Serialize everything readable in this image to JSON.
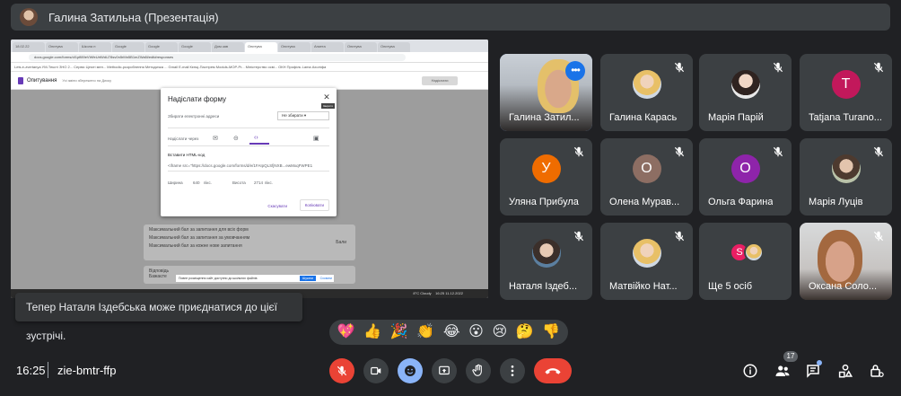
{
  "presenter_bar": {
    "name": "Галина Затильна (Презентація)"
  },
  "presentation": {
    "browser_tabs": [
      "18.02.22",
      "Опитува",
      "Школа н",
      "Google",
      "Google",
      "Google",
      "Дом.зав",
      "Опитува",
      "Опитува",
      "Анкета",
      "Опитува",
      "Опитува"
    ],
    "url": "docs.google.com/forms/d/1pfl89eVWfeUrtWdU78sv0n5rMn5B1mZWa5l/edit#responses",
    "bookmarks": "Lets.e-zvertanya   УМ-Тексті ЗНО 2...   Сервіс Ціноті мен...   Methodic-розроблення   Методичка ...   Gmail   E-mail   Кєнці-Пастірем   Moduls-MOP-Pr...   Міністерство осві...   ОКН Профіль   Lama Ахоліфа",
    "form_title": "Опитування",
    "form_subtitle": "Усі зміни збережено на Диску",
    "send_button": "Надіслати",
    "dialog": {
      "title": "Надіслати форму",
      "close_tooltip": "Закрити",
      "collect_emails_label": "Збирати електронні адреси",
      "collect_emails_value": "Не збирати",
      "send_via_label": "Надіслати через",
      "embed_label": "Вставити HTML-код",
      "embed_code": "<iframe src=\"https://docs.google.com/forms/d/e/1FAIpQLSfjNXB...ewMxqFWPE1",
      "width_label": "Ширина",
      "width_value": "640",
      "width_unit": "пікс.",
      "height_label": "Висота",
      "height_value": "2714",
      "height_unit": "пікс.",
      "cancel": "Скасувати",
      "copy": "Копіювати"
    },
    "form_lines": [
      "Максимальний бал за запитання для всіх форм",
      "Максимальний бал за запитання за умовчанням",
      "Максимальний бал за кожне нове запитання",
      "Відповідь",
      "Бажаєте"
    ],
    "points_label": "Бали",
    "bottom_notice": "Повне розміщення сайт доступно до шкільних файлів",
    "notice_btn1": "Шукати",
    "notice_btn2": "Сховати",
    "taskbar_temp": "8°C Cloudy",
    "taskbar_time": "16:25",
    "taskbar_date": "11.12.2022"
  },
  "participants": [
    {
      "name": "Галина Затил...",
      "type": "video1",
      "active": true
    },
    {
      "name": "Галина Карась",
      "type": "photo2",
      "muted": true
    },
    {
      "name": "Марія Парій",
      "type": "photo3",
      "muted": true
    },
    {
      "name": "Tatjana Turano...",
      "type": "letter",
      "letter": "T",
      "color": "#c2185b",
      "muted": true
    },
    {
      "name": "Уляна Прибула",
      "type": "letter",
      "letter": "У",
      "color": "#ef6c00",
      "muted": true
    },
    {
      "name": "Олена Мурав...",
      "type": "letter",
      "letter": "О",
      "color": "#8d6e63",
      "muted": true
    },
    {
      "name": "Ольга Фарина",
      "type": "letter",
      "letter": "О",
      "color": "#8e24aa",
      "muted": true
    },
    {
      "name": "Марія Луців",
      "type": "photo4",
      "muted": true
    },
    {
      "name": "Наталя Іздеб...",
      "type": "photo5",
      "muted": true
    },
    {
      "name": "Матвійко Нат...",
      "type": "photo2",
      "muted": true
    },
    {
      "name": "Ще 5 осіб",
      "type": "more",
      "mini_letter": "S",
      "mini_color": "#e91e63",
      "muted": false
    },
    {
      "name": "Оксана Соло...",
      "type": "video2",
      "muted": true
    }
  ],
  "toast": "Тепер Наталя Іздебська може приєднатися до цієї зустрічі.",
  "reactions": [
    "💖",
    "👍",
    "🎉",
    "👏",
    "😂",
    "😮",
    "😢",
    "🤔",
    "👎"
  ],
  "bottom": {
    "time": "16:25",
    "meeting_code": "zie-bmtr-ffp",
    "participant_count": "17"
  },
  "colors": {
    "background": "#202124",
    "tile": "#3c4043",
    "leave_red": "#ea4335",
    "accent_blue": "#8ab4f8"
  },
  "icons": {
    "mic": "mic-off-icon",
    "camera": "camera-icon",
    "emoji": "emoji-icon",
    "present": "present-screen-icon",
    "hand": "raise-hand-icon",
    "more": "more-vert-icon",
    "leave": "call-end-icon",
    "info": "info-icon",
    "people": "people-icon",
    "chat": "chat-icon",
    "activities": "activities-icon",
    "lock": "host-controls-icon"
  }
}
